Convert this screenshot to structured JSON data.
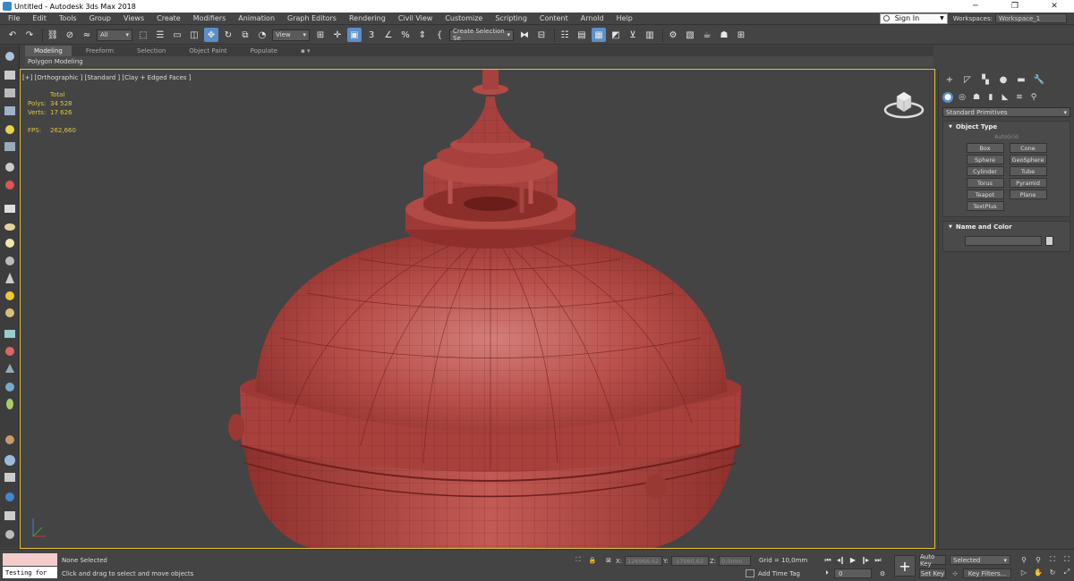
{
  "window": {
    "title": "Untitled - Autodesk 3ds Max 2018",
    "minimize": "─",
    "maximize": "❐",
    "close": "✕"
  },
  "menu": {
    "items": [
      "File",
      "Edit",
      "Tools",
      "Group",
      "Views",
      "Create",
      "Modifiers",
      "Animation",
      "Graph Editors",
      "Rendering",
      "Civil View",
      "Customize",
      "Scripting",
      "Content",
      "Arnold",
      "Help"
    ],
    "sign_in": "Sign In",
    "workspaces_label": "Workspaces:",
    "workspace_value": "Workspace_1"
  },
  "toolbar": {
    "selection_filter": "All",
    "ref_coord": "View",
    "named_selection": "Create Selection Se",
    "snap_label": "3",
    "angle_label": "%"
  },
  "ribbon": {
    "tabs": [
      "Modeling",
      "Freeform",
      "Selection",
      "Object Paint",
      "Populate"
    ],
    "active_tab": "Modeling",
    "panel_label": "Polygon Modeling"
  },
  "viewport": {
    "label": "[+] [Orthographic ] [Standard ] [Clay + Edged Faces ]",
    "stats_total": "Total",
    "polys_label": "Polys:",
    "polys_value": "34 528",
    "verts_label": "Verts:",
    "verts_value": "17 626",
    "fps_label": "FPS:",
    "fps_value": "262,660",
    "mesh_color": "#b34d49",
    "border_color": "#e5c232"
  },
  "command_panel": {
    "category": "Standard Primitives",
    "object_type_title": "Object Type",
    "autogrid": "AutoGrid",
    "buttons": [
      "Box",
      "Cone",
      "Sphere",
      "GeoSphere",
      "Cylinder",
      "Tube",
      "Torus",
      "Pyramid",
      "Teapot",
      "Plane",
      "TextPlus"
    ],
    "name_color_title": "Name and Color"
  },
  "status": {
    "script_text": "Testing for",
    "selection": "None Selected",
    "prompt": "Click and drag to select and move objects",
    "x_label": "X:",
    "x_value": "126966,62",
    "y_label": "Y:",
    "y_value": "-17060,62",
    "z_label": "Z:",
    "z_value": "0,0mm",
    "grid": "Grid = 10,0mm",
    "add_time_tag": "Add Time Tag",
    "frame": "0",
    "auto_key": "Auto Key",
    "set_key": "Set Key",
    "selected": "Selected",
    "key_filters": "Key Filters..."
  }
}
